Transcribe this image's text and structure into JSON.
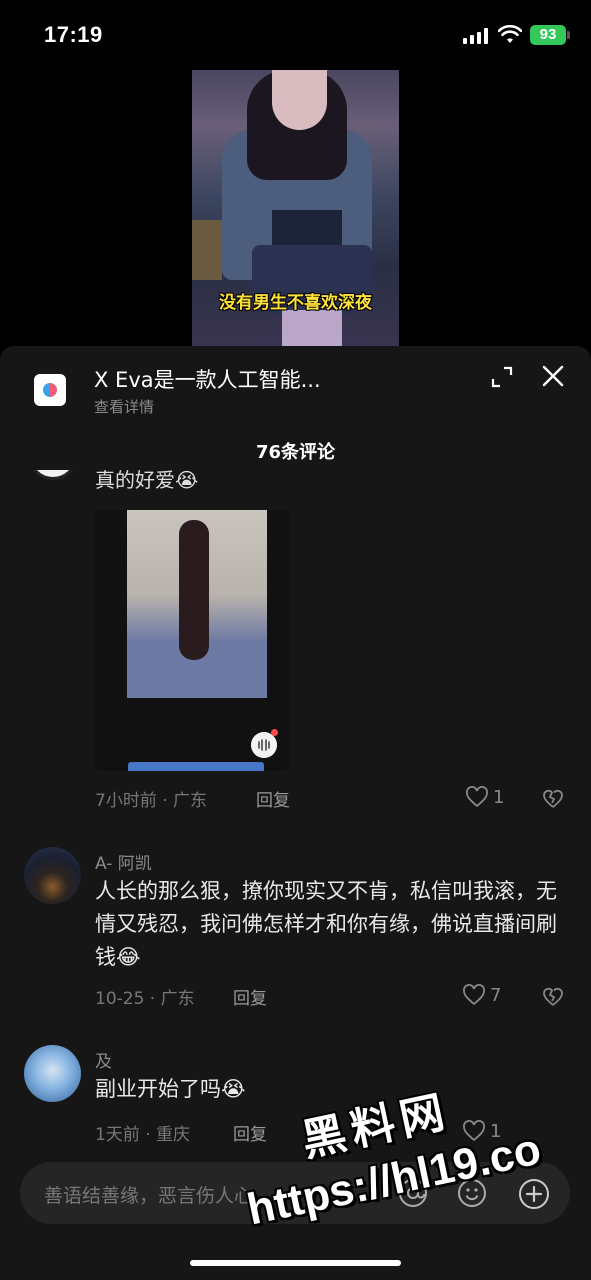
{
  "status_bar": {
    "time": "17:19",
    "battery": "93"
  },
  "video": {
    "caption": "没有男生不喜欢深夜"
  },
  "ad": {
    "title": "X Eva是一款人工智能...",
    "subtitle": "查看详情"
  },
  "comments_header": {
    "count_label": "76条评论"
  },
  "partial_comment": {
    "text": "真的好爱😭"
  },
  "comments": [
    {
      "time_location": "7小时前 · 广东",
      "reply_label": "回复",
      "likes": "1"
    },
    {
      "username": "A- 阿凯",
      "text": "人长的那么狠，撩你现实又不肯，私信叫我滚，无情又残忍，我问佛怎样才和你有缘，佛说直播间刷钱😂",
      "time_location": "10-25 · 广东",
      "reply_label": "回复",
      "likes": "7"
    },
    {
      "username": "及",
      "text": "副业开始了吗😭",
      "time_location": "1天前 · 重庆",
      "reply_label": "回复",
      "likes": "1"
    }
  ],
  "input": {
    "placeholder": "善语结善缘，恶言伤人心"
  },
  "watermark": {
    "logo": "黑料网",
    "url": "https://hl19.co"
  },
  "colors": {
    "background": "#000000",
    "sheet": "#161616",
    "caption": "#ffe23a",
    "battery": "#34c759"
  }
}
